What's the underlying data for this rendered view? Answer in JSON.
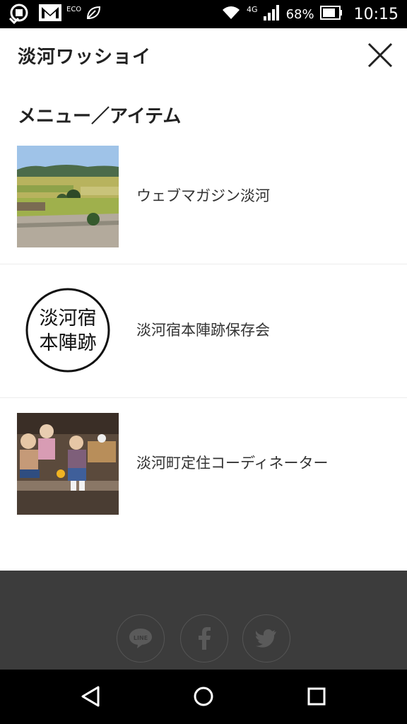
{
  "status_bar": {
    "eco_label": "ECO",
    "network": "4G",
    "battery": "68%",
    "time": "10:15"
  },
  "header": {
    "title": "淡河ワッショイ"
  },
  "menu": {
    "heading": "メニュー／アイテム",
    "items": [
      {
        "label": "ウェブマガジン淡河",
        "thumb": "landscape-photo"
      },
      {
        "label": "淡河宿本陣跡保存会",
        "thumb": "logo",
        "logo_line1": "淡河宿",
        "logo_line2": "本陣跡"
      },
      {
        "label": "淡河町定住コーディネーター",
        "thumb": "children-photo"
      }
    ]
  },
  "footer": {
    "social": [
      {
        "name": "line",
        "label": "LINE"
      },
      {
        "name": "facebook",
        "label": "f"
      },
      {
        "name": "twitter",
        "label": "twitter-bird"
      }
    ]
  },
  "colors": {
    "status_bar": "#000000",
    "footer": "#3c3c3c",
    "social_icon": "#5a5a5a",
    "text": "#222222"
  }
}
